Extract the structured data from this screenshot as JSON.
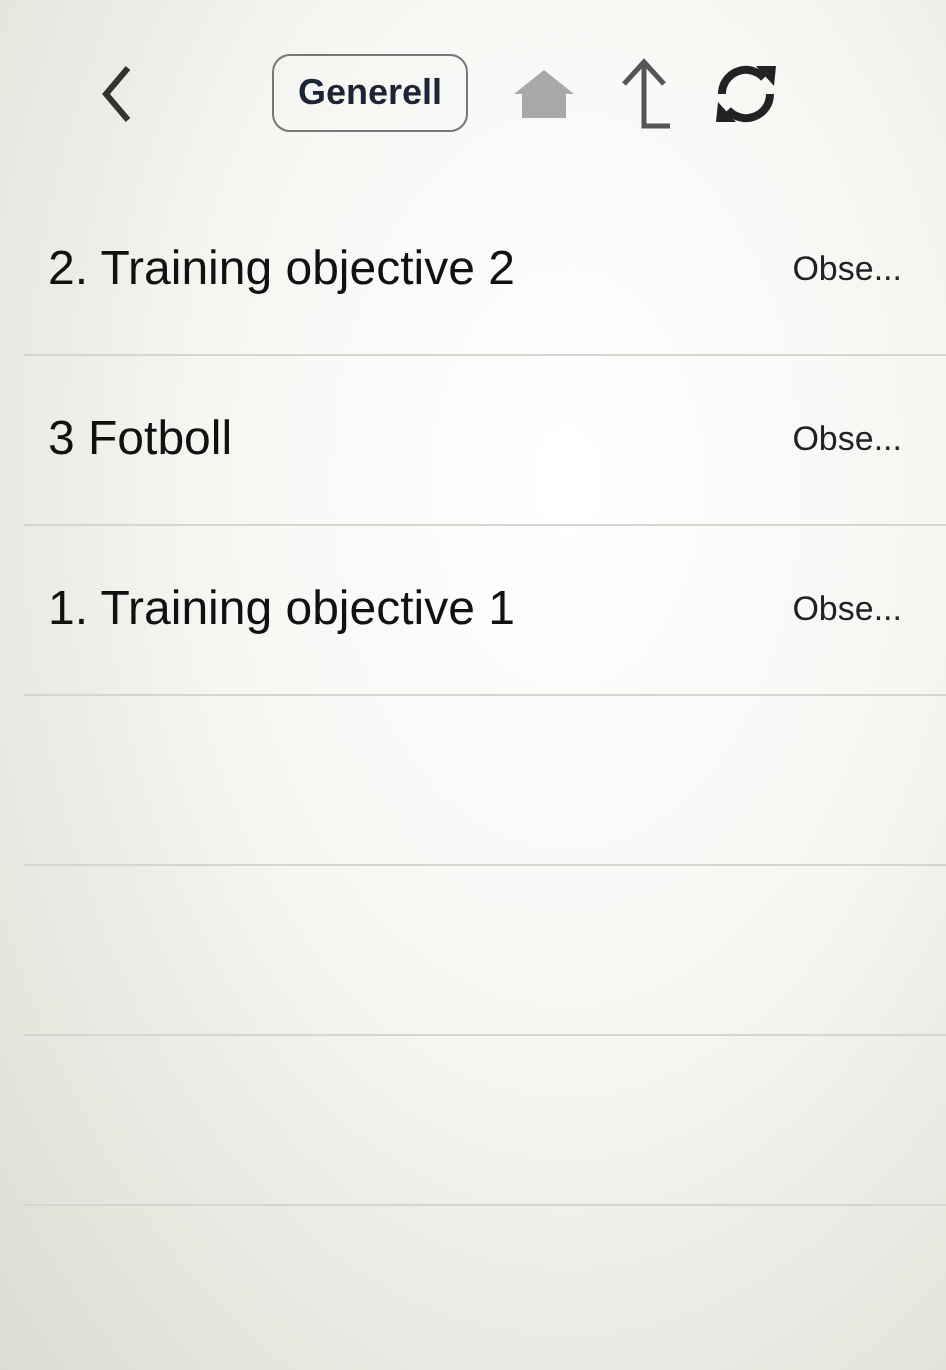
{
  "toolbar": {
    "filter_button": "Generell",
    "home_disabled": true
  },
  "rows": [
    {
      "title": "2. Training objective 2",
      "detail": "Obse..."
    },
    {
      "title": "3 Fotboll",
      "detail": "Obse..."
    },
    {
      "title": "1. Training objective 1",
      "detail": "Obse..."
    }
  ]
}
